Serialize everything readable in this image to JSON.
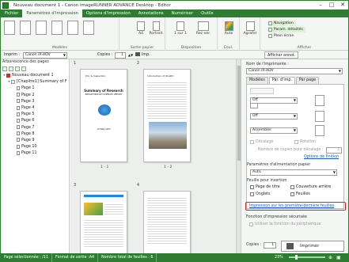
{
  "window": {
    "title": "Nouveau document 1 - Canon imageRUNNER ADVANCE Desktop - Editor",
    "controls": [
      "–",
      "□",
      "✕"
    ]
  },
  "menu": [
    "Fichier",
    "Paramètres d'impression",
    "Options d'impression",
    "Annotations",
    "Numériser",
    "Outils"
  ],
  "ribbon": {
    "groups": [
      "Modèles",
      "Sortie papier",
      "Disposition",
      "Coul.",
      "Afficher"
    ],
    "paper_size": "A4",
    "orientation": "Portrait",
    "layout": "1 sur 1",
    "duplex": "Rec-ver.",
    "color": "Auto",
    "staple": "Agrafer",
    "show_buttons": [
      "Navigation",
      "Param. détaillés",
      "Plein écran"
    ]
  },
  "toolbar": {
    "printer_label": "Imprim :",
    "printer_value": "Canon iR-ADV",
    "copies_label": "Copies :",
    "copies_value": "1",
    "imp_label": "Imp.",
    "annot_label": "Afficher annot."
  },
  "tree": {
    "title": "Arborescence des pages",
    "root": "Nouveau document 1",
    "chapter": "[Chapitre1] Summary of F",
    "pages": [
      "Page 1",
      "Page 2",
      "Page 3",
      "Page 4",
      "Page 5",
      "Page 6",
      "Page 7",
      "Page 8",
      "Page 9",
      "Page 10",
      "Page 11"
    ]
  },
  "preview": {
    "pages": [
      {
        "num": "1",
        "label": "1 - 1",
        "heading": "Summary of Research",
        "sub": "BREAKTHROUGH SUMMARY REPORT",
        "date": "12 MAR 2023"
      },
      {
        "num": "2",
        "label": "1 - 2",
        "heading": "Introduction of IR-ADV"
      },
      {
        "num": "3",
        "label": ""
      },
      {
        "num": "4",
        "label": ""
      }
    ]
  },
  "settings": {
    "printer_name_label": "Nom de l'imprimante :",
    "printer_name_value": "Canon iR-ADV",
    "tabs": [
      "Modèles",
      "Par. d'imp.",
      "Par page"
    ],
    "off1": "Off",
    "off2": "Off",
    "assemble": "Assembler",
    "decalage": "Décalage",
    "rotation": "Rotation",
    "copies_offset_label": "Nombre de copies pour décalage :",
    "copies_offset_value": "1",
    "finition_link": "Options de finition",
    "paper_source_label": "Paramètres d'alimentation papier",
    "paper_source_value": "Auto",
    "insert_label": "Feuille pour insertion",
    "page_title": "Page de titre",
    "back_cover": "Couverture arrière",
    "tabs_opt": "Onglets",
    "sheets": "Feuilles",
    "print_first_last": "Impression sur les première/dernière feuilles",
    "secure_label": "Fonction d'impression sécurisée",
    "use_device": "Utiliser la fonction du périphérique",
    "copies_label": "Copies :",
    "copies_value": "1",
    "print_button": "Imprimer"
  },
  "status": {
    "selected": "Page sélectionnée : /11",
    "format": "Format de sortie :A4",
    "sheets": "Nombre total de feuilles : 6",
    "zoom": "23%"
  },
  "colors": {
    "accent": "#2e7d32",
    "highlight": "#e02020",
    "link": "#1a5fb4"
  }
}
